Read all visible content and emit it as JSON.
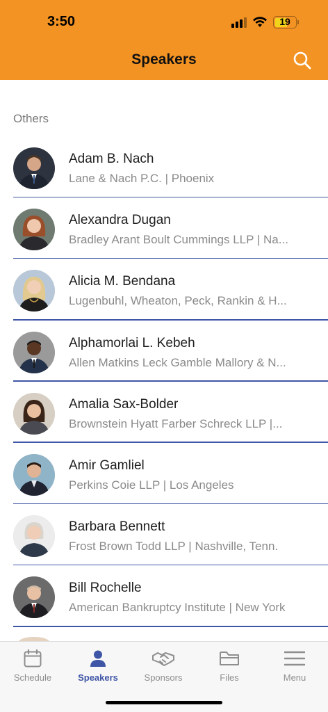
{
  "status_bar": {
    "time": "3:50",
    "battery": "19"
  },
  "header": {
    "title": "Speakers"
  },
  "section": {
    "label": "Others"
  },
  "speakers": [
    {
      "name": "Adam B. Nach",
      "detail": "Lane & Nach P.C. | Phoenix"
    },
    {
      "name": "Alexandra Dugan",
      "detail": "Bradley Arant Boult Cummings LLP | Na..."
    },
    {
      "name": "Alicia M. Bendana",
      "detail": "Lugenbuhl, Wheaton, Peck, Rankin & H..."
    },
    {
      "name": "Alphamorlai L. Kebeh",
      "detail": "Allen Matkins Leck Gamble Mallory & N..."
    },
    {
      "name": "Amalia Sax-Bolder",
      "detail": "Brownstein Hyatt Farber Schreck LLP |..."
    },
    {
      "name": "Amir Gamliel",
      "detail": "Perkins Coie LLP | Los Angeles"
    },
    {
      "name": "Barbara Bennett",
      "detail": "Frost Brown Todd LLP | Nashville, Tenn."
    },
    {
      "name": "Bill Rochelle",
      "detail": "American Bankruptcy Institute | New York"
    }
  ],
  "tabs": [
    {
      "label": "Schedule",
      "icon": "calendar-icon"
    },
    {
      "label": "Speakers",
      "icon": "person-icon"
    },
    {
      "label": "Sponsors",
      "icon": "handshake-icon"
    },
    {
      "label": "Files",
      "icon": "folder-icon"
    },
    {
      "label": "Menu",
      "icon": "hamburger-icon"
    }
  ],
  "colors": {
    "header": "#F39323",
    "accent": "#3F55A6",
    "divider": "#3F55A6"
  }
}
